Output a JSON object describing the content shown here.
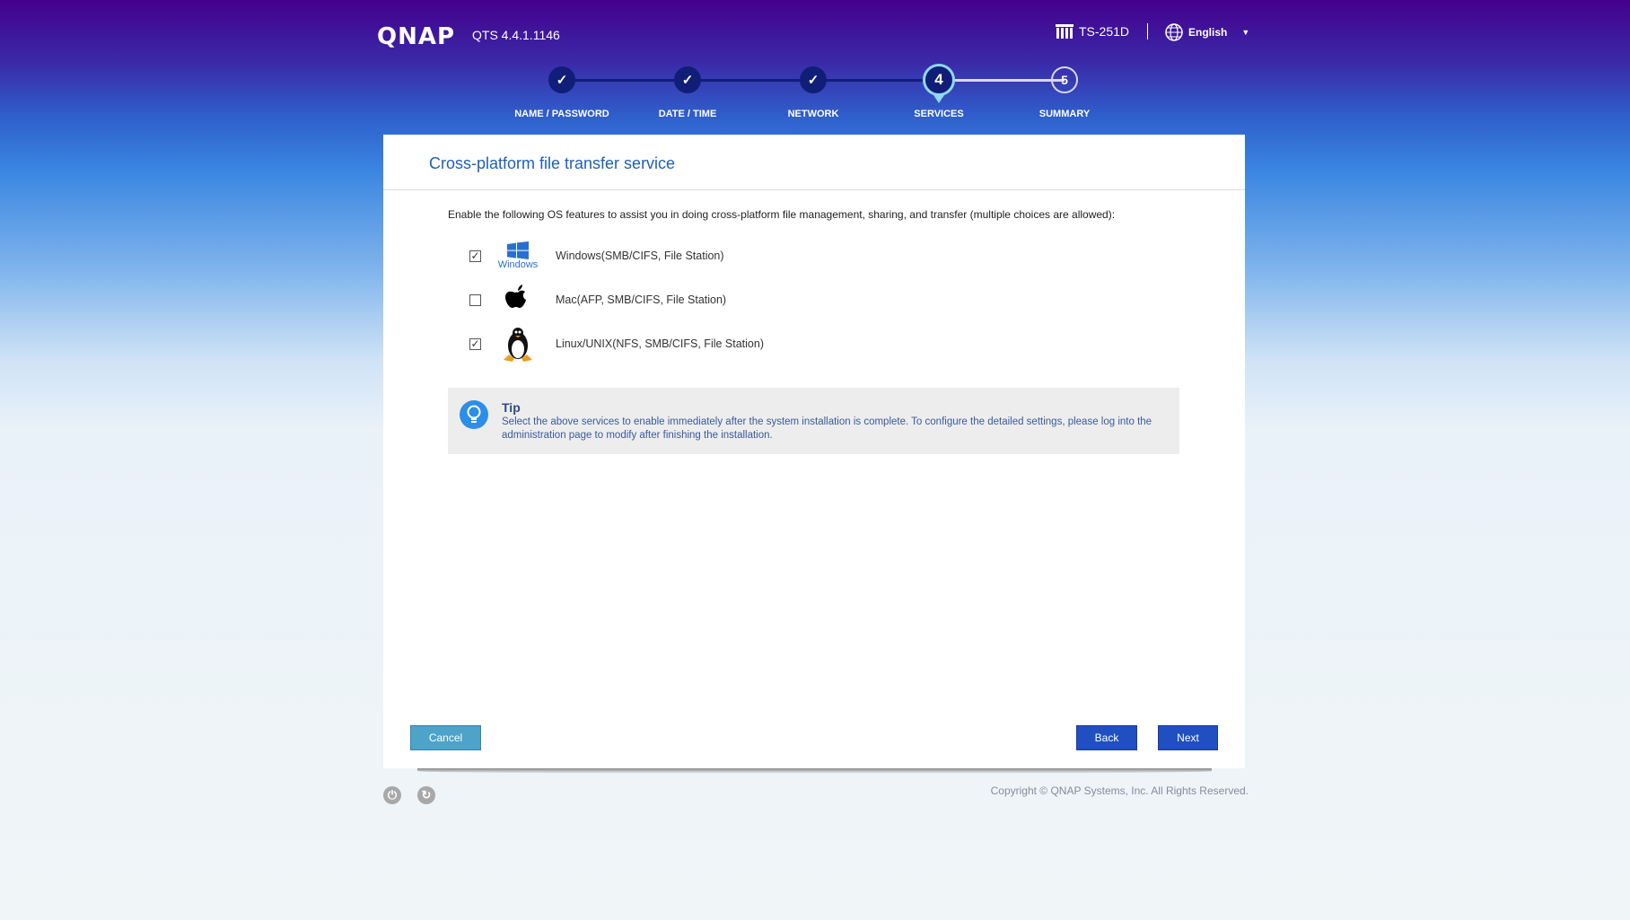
{
  "header": {
    "logo": "QNAP",
    "version": "QTS 4.4.1.1146",
    "model": "TS-251D",
    "language": "English"
  },
  "steps": [
    {
      "label": "NAME / PASSWORD",
      "state": "done",
      "mark": "✓"
    },
    {
      "label": "DATE / TIME",
      "state": "done",
      "mark": "✓"
    },
    {
      "label": "NETWORK",
      "state": "done",
      "mark": "✓"
    },
    {
      "label": "SERVICES",
      "state": "current",
      "mark": "4"
    },
    {
      "label": "SUMMARY",
      "state": "todo",
      "mark": "5"
    }
  ],
  "panel": {
    "title": "Cross-platform file transfer service",
    "description": "Enable the following OS features to assist you in doing cross-platform file management, sharing, and transfer (multiple choices are allowed):",
    "options": [
      {
        "label": "Windows(SMB/CIFS, File Station)",
        "checked": true,
        "icon": "windows-icon",
        "icon_caption": "Windows"
      },
      {
        "label": "Mac(AFP, SMB/CIFS, File Station)",
        "checked": false,
        "icon": "apple-icon"
      },
      {
        "label": "Linux/UNIX(NFS, SMB/CIFS, File Station)",
        "checked": true,
        "icon": "tux-penguin-icon"
      }
    ],
    "tip": {
      "title": "Tip",
      "text": "Select the above services to enable immediately after the system installation is complete. To configure the detailed settings, please log into the administration page to modify after finishing the installation."
    },
    "buttons": {
      "cancel": "Cancel",
      "back": "Back",
      "next": "Next"
    }
  },
  "footer": {
    "copyright": "Copyright © QNAP Systems, Inc. All Rights Reserved."
  },
  "colors": {
    "accent": "#1f4fc0",
    "step_done": "#101e78",
    "title": "#1f5fb8"
  }
}
